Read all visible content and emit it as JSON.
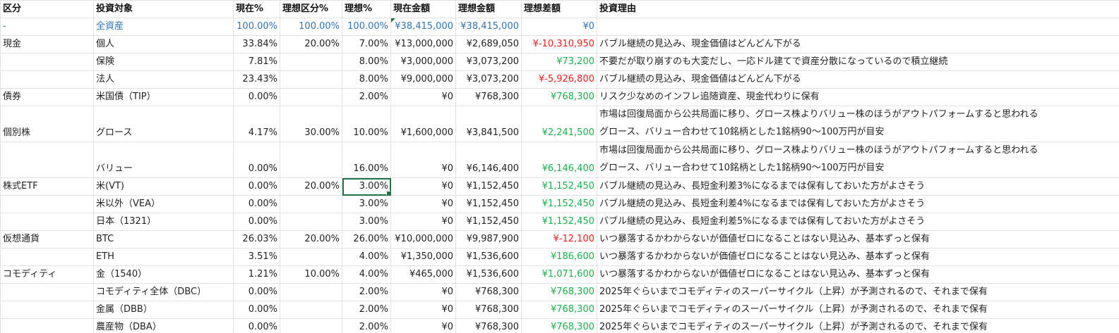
{
  "headers": {
    "category": "区分",
    "target": "投資対象",
    "current_pct": "現在%",
    "ideal_cat_pct": "理想区分%",
    "ideal_pct": "理想%",
    "current_amt": "現在金額",
    "ideal_amt": "理想金額",
    "diff": "理想差額",
    "reason": "投資理由"
  },
  "total": {
    "category": "-",
    "target": "全資産",
    "current_pct": "100.00%",
    "ideal_cat_pct": "100.00%",
    "ideal_pct": "100.00%",
    "current_amt": "¥38,415,000",
    "ideal_amt": "¥38,415,000",
    "diff": "¥0"
  },
  "rows": [
    {
      "category": "現金",
      "target": "個人",
      "current_pct": "33.84%",
      "ideal_cat_pct": "20.00%",
      "ideal_pct": "7.00%",
      "current_amt": "¥13,000,000",
      "ideal_amt": "¥2,689,050",
      "diff": "¥-10,310,950",
      "reason": "バブル継続の見込み、現金価値はどんどん下がる"
    },
    {
      "category": "",
      "target": "保険",
      "current_pct": "7.81%",
      "ideal_cat_pct": "",
      "ideal_pct": "8.00%",
      "current_amt": "¥3,000,000",
      "ideal_amt": "¥3,073,200",
      "diff": "¥73,200",
      "reason": "不要だが取り崩すのも大変だし、一応ドル建てで資産分散になっているので積立継続"
    },
    {
      "category": "",
      "target": "法人",
      "current_pct": "23.43%",
      "ideal_cat_pct": "",
      "ideal_pct": "8.00%",
      "current_amt": "¥9,000,000",
      "ideal_amt": "¥3,073,200",
      "diff": "¥-5,926,800",
      "reason": "バブル継続の見込み、現金価値はどんどん下がる"
    },
    {
      "category": "債券",
      "target": "米国債（TIP）",
      "current_pct": "0.00%",
      "ideal_cat_pct": "",
      "ideal_pct": "2.00%",
      "current_amt": "¥0",
      "ideal_amt": "¥768,300",
      "diff": "¥768,300",
      "reason": "リスク少なめのインフレ追随資産、現金代わりに保有"
    },
    {
      "category": "個別株",
      "target": "グロース",
      "current_pct": "4.17%",
      "ideal_cat_pct": "30.00%",
      "ideal_pct": "10.00%",
      "current_amt": "¥1,600,000",
      "ideal_amt": "¥3,841,500",
      "diff": "¥2,241,500",
      "reason": "市場は回復局面から公共局面に移り、グロース株よりバリュー株のほうがアウトパフォームすると思われる",
      "reason2": "グロース、バリュー合わせて10銘柄とした1銘柄90〜100万円が目安"
    },
    {
      "category": "",
      "target": "バリュー",
      "current_pct": "0.00%",
      "ideal_cat_pct": "",
      "ideal_pct": "16.00%",
      "current_amt": "¥0",
      "ideal_amt": "¥6,146,400",
      "diff": "¥6,146,400",
      "reason": "市場は回復局面から公共局面に移り、グロース株よりバリュー株のほうがアウトパフォームすると思われる",
      "reason2": "グロース、バリュー合わせて10銘柄とした1銘柄90〜100万円が目安"
    },
    {
      "category": "株式ETF",
      "target": "米(VT)",
      "current_pct": "0.00%",
      "ideal_cat_pct": "20.00%",
      "ideal_pct": "3.00%",
      "current_amt": "¥0",
      "ideal_amt": "¥1,152,450",
      "diff": "¥1,152,450",
      "reason": "バブル継続の見込み、長短金利差3%になるまでは保有しておいた方がよさそう"
    },
    {
      "category": "",
      "target": "米以外（VEA）",
      "current_pct": "0.00%",
      "ideal_cat_pct": "",
      "ideal_pct": "3.00%",
      "current_amt": "¥0",
      "ideal_amt": "¥1,152,450",
      "diff": "¥1,152,450",
      "reason": "バブル継続の見込み、長短金利差4%になるまでは保有しておいた方がよさそう"
    },
    {
      "category": "",
      "target": "日本（1321）",
      "current_pct": "0.00%",
      "ideal_cat_pct": "",
      "ideal_pct": "3.00%",
      "current_amt": "¥0",
      "ideal_amt": "¥1,152,450",
      "diff": "¥1,152,450",
      "reason": "バブル継続の見込み、長短金利差5%になるまでは保有しておいた方がよさそう"
    },
    {
      "category": "仮想通貨",
      "target": "BTC",
      "current_pct": "26.03%",
      "ideal_cat_pct": "20.00%",
      "ideal_pct": "26.00%",
      "current_amt": "¥10,000,000",
      "ideal_amt": "¥9,987,900",
      "diff": "¥-12,100",
      "reason": "いつ暴落するかわからないが価値ゼロになることはない見込み、基本ずっと保有"
    },
    {
      "category": "",
      "target": "ETH",
      "current_pct": "3.51%",
      "ideal_cat_pct": "",
      "ideal_pct": "4.00%",
      "current_amt": "¥1,350,000",
      "ideal_amt": "¥1,536,600",
      "diff": "¥186,600",
      "reason": "いつ暴落するかわからないが価値ゼロになることはない見込み、基本ずっと保有"
    },
    {
      "category": "コモディティ",
      "target": "金（1540）",
      "current_pct": "1.21%",
      "ideal_cat_pct": "10.00%",
      "ideal_pct": "4.00%",
      "current_amt": "¥465,000",
      "ideal_amt": "¥1,536,600",
      "diff": "¥1,071,600",
      "reason": "いつ暴落するかわからないが価値ゼロになることはない見込み、基本ずっと保有"
    },
    {
      "category": "",
      "target": "コモディティ全体（DBC）",
      "current_pct": "0.00%",
      "ideal_cat_pct": "",
      "ideal_pct": "2.00%",
      "current_amt": "¥0",
      "ideal_amt": "¥768,300",
      "diff": "¥768,300",
      "reason": "2025年ぐらいまでコモディティのスーパーサイクル（上昇）が予測されるので、それまで保有"
    },
    {
      "category": "",
      "target": "金属（DBB）",
      "current_pct": "0.00%",
      "ideal_cat_pct": "",
      "ideal_pct": "2.00%",
      "current_amt": "¥0",
      "ideal_amt": "¥768,300",
      "diff": "¥768,300",
      "reason": "2025年ぐらいまでコモディティのスーパーサイクル（上昇）が予測されるので、それまで保有"
    },
    {
      "category": "",
      "target": "農産物（DBA）",
      "current_pct": "0.00%",
      "ideal_cat_pct": "",
      "ideal_pct": "2.00%",
      "current_amt": "¥0",
      "ideal_amt": "¥768,300",
      "diff": "¥768,300",
      "reason": "2025年ぐらいまでコモディティのスーパーサイクル（上昇）が予測されるので、それまで保有"
    }
  ],
  "colors": {
    "total_text": "#2e75b6",
    "positive": "#17b34a",
    "negative": "#ff1a1a",
    "selection": "#217346"
  }
}
